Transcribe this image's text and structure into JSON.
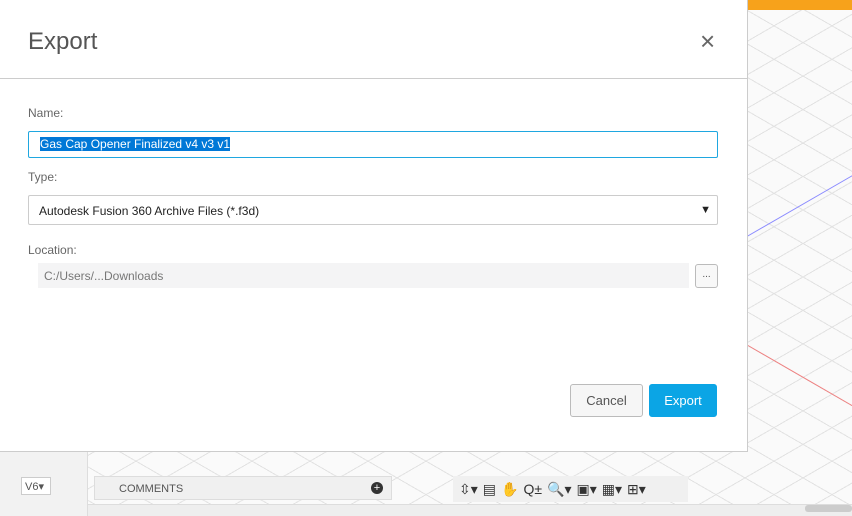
{
  "dialog": {
    "title": "Export",
    "close_icon": "×",
    "name_label": "Name:",
    "name_value": "Gas Cap Opener Finalized v4 v3 v1",
    "type_label": "Type:",
    "type_value": "Autodesk Fusion 360 Archive Files (*.f3d)",
    "location_label": "Location:",
    "location_value": "C:/Users/...Downloads",
    "browse_label": "...",
    "cancel_label": "Cancel",
    "export_label": "Export"
  },
  "background": {
    "version_badge": "V6▾",
    "comments_label": "COMMENTS",
    "comments_add": "+",
    "toolbar": [
      "⇳▾",
      "▤",
      "✋",
      "Q±",
      "🔍▾",
      "▣▾",
      "▦▾",
      "⊞▾"
    ]
  },
  "colors": {
    "accent": "#0ba5e5",
    "highlight": "#0078d7",
    "orange": "#f7a21b"
  }
}
